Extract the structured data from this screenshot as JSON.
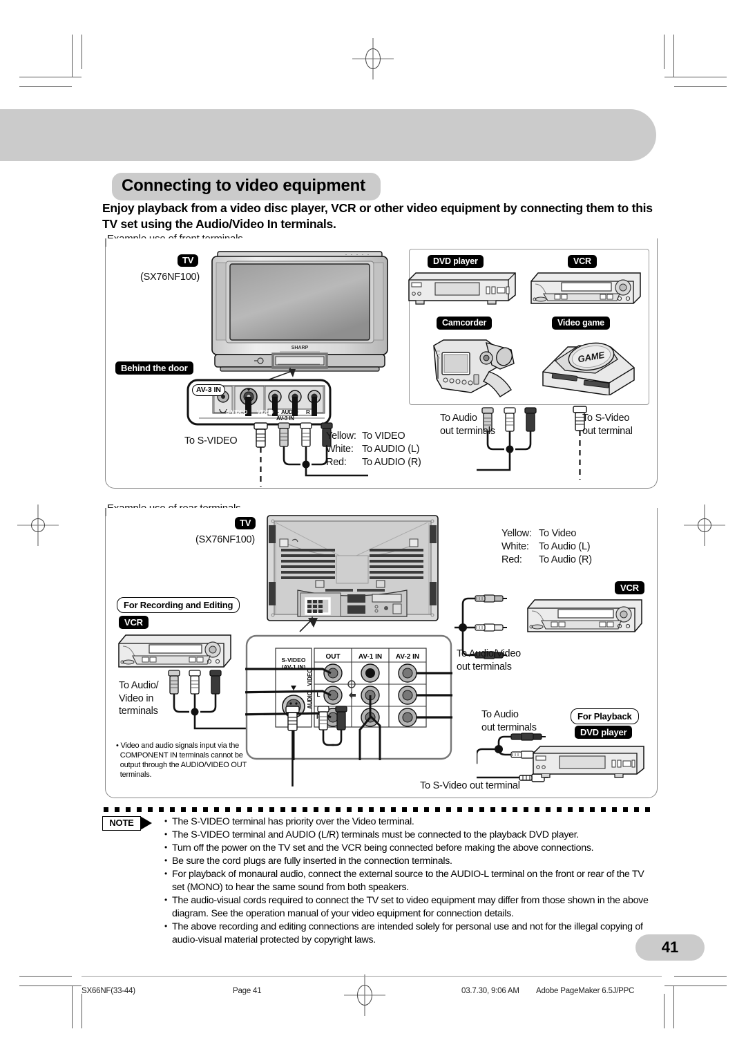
{
  "header": {
    "title": "Connecting to video equipment",
    "subtitle": "Enjoy playback from a video disc player, VCR or other video equipment by connecting them to this TV set using the Audio/Video In terminals."
  },
  "sections": {
    "front": {
      "caption": "Example use of front terminals",
      "tv_badge": "TV",
      "tv_model": "(SX76NF100)",
      "behind_door_badge": "Behind the door",
      "av_panel_label": "AV-3 IN",
      "panel_jack_labels": [
        "S-VIDEO",
        "VIDEO",
        "L",
        "AUDIO",
        "R"
      ],
      "panel_sub_label": "AV-3 IN",
      "to_svideo": "To S-VIDEO",
      "color_legend": [
        {
          "color": "Yellow:",
          "target": "To VIDEO"
        },
        {
          "color": "White:",
          "target": "To AUDIO (L)"
        },
        {
          "color": "Red:",
          "target": "To AUDIO (R)"
        }
      ],
      "devices": [
        {
          "label": "DVD player",
          "type": "dvd"
        },
        {
          "label": "VCR",
          "type": "vcr"
        },
        {
          "label": "Camcorder",
          "type": "camcorder"
        },
        {
          "label": "Video game",
          "type": "game",
          "disc_text": "GAME"
        }
      ],
      "to_audio_out": "To Audio\nout terminals",
      "to_svideo_out": "To S-Video\nout terminal"
    },
    "rear": {
      "caption": "Example use of rear terminals",
      "tv_badge": "TV",
      "tv_model": "(SX76NF100)",
      "recording_badge": "For Recording and Editing",
      "vcr_badge_left": "VCR",
      "vcr_badge_right": "VCR",
      "to_audio_video_in": "To Audio/\nVideo in\nterminals",
      "color_legend": [
        {
          "color": "Yellow:",
          "target": "To Video"
        },
        {
          "color": "White:",
          "target": "To Audio (L)"
        },
        {
          "color": "Red:",
          "target": "To Audio (R)"
        }
      ],
      "terminal_panel": {
        "col_headers": [
          "OUT",
          "AV-1 IN",
          "AV-2 IN"
        ],
        "svideo_label": "S-VIDEO\n(AV-1 IN)",
        "row_labels": [
          "VIDEO",
          "AUDIO",
          "L",
          "R"
        ]
      },
      "to_audio_video_out": "To Audio/Video\nout terminals",
      "to_audio_out": "To Audio\nout terminals",
      "to_svideo_out": "To S-Video out terminal",
      "playback_badge": "For Playback",
      "dvd_badge": "DVD player",
      "inner_note": "• Video and audio signals input via the\n  COMPONENT IN terminals cannot be\n  output through the AUDIO/VIDEO OUT\n  terminals."
    }
  },
  "notes": {
    "marker": "NOTE",
    "items": [
      "The S-VIDEO terminal has priority over the Video terminal.",
      "The S-VIDEO terminal and AUDIO (L/R) terminals must be connected to the playback DVD player.",
      "Turn off the power on the TV set and the VCR being connected before making the above connections.",
      "Be sure the cord plugs are fully inserted in the connection terminals.",
      "For playback of monaural audio, connect the external source to the AUDIO-L terminal on the front or rear of the TV set (MONO) to hear the same sound from both speakers.",
      "The audio-visual cords required to connect the TV set to video equipment may differ from those shown in the above diagram. See the operation manual of your video equipment for connection details.",
      "The above recording and editing connections are intended solely for personal use and not for the illegal copying of audio-visual material protected by copyright laws."
    ]
  },
  "page_number": "41",
  "footer": {
    "file": "SX66NF(33-44)",
    "page": "Page 41",
    "timestamp": "03.7.30, 9:06 AM",
    "software": "Adobe PageMaker 6.5J/PPC"
  },
  "colors": {
    "band": "#cbcbcb",
    "badge_bg": "#000000",
    "frame": "#888888"
  }
}
